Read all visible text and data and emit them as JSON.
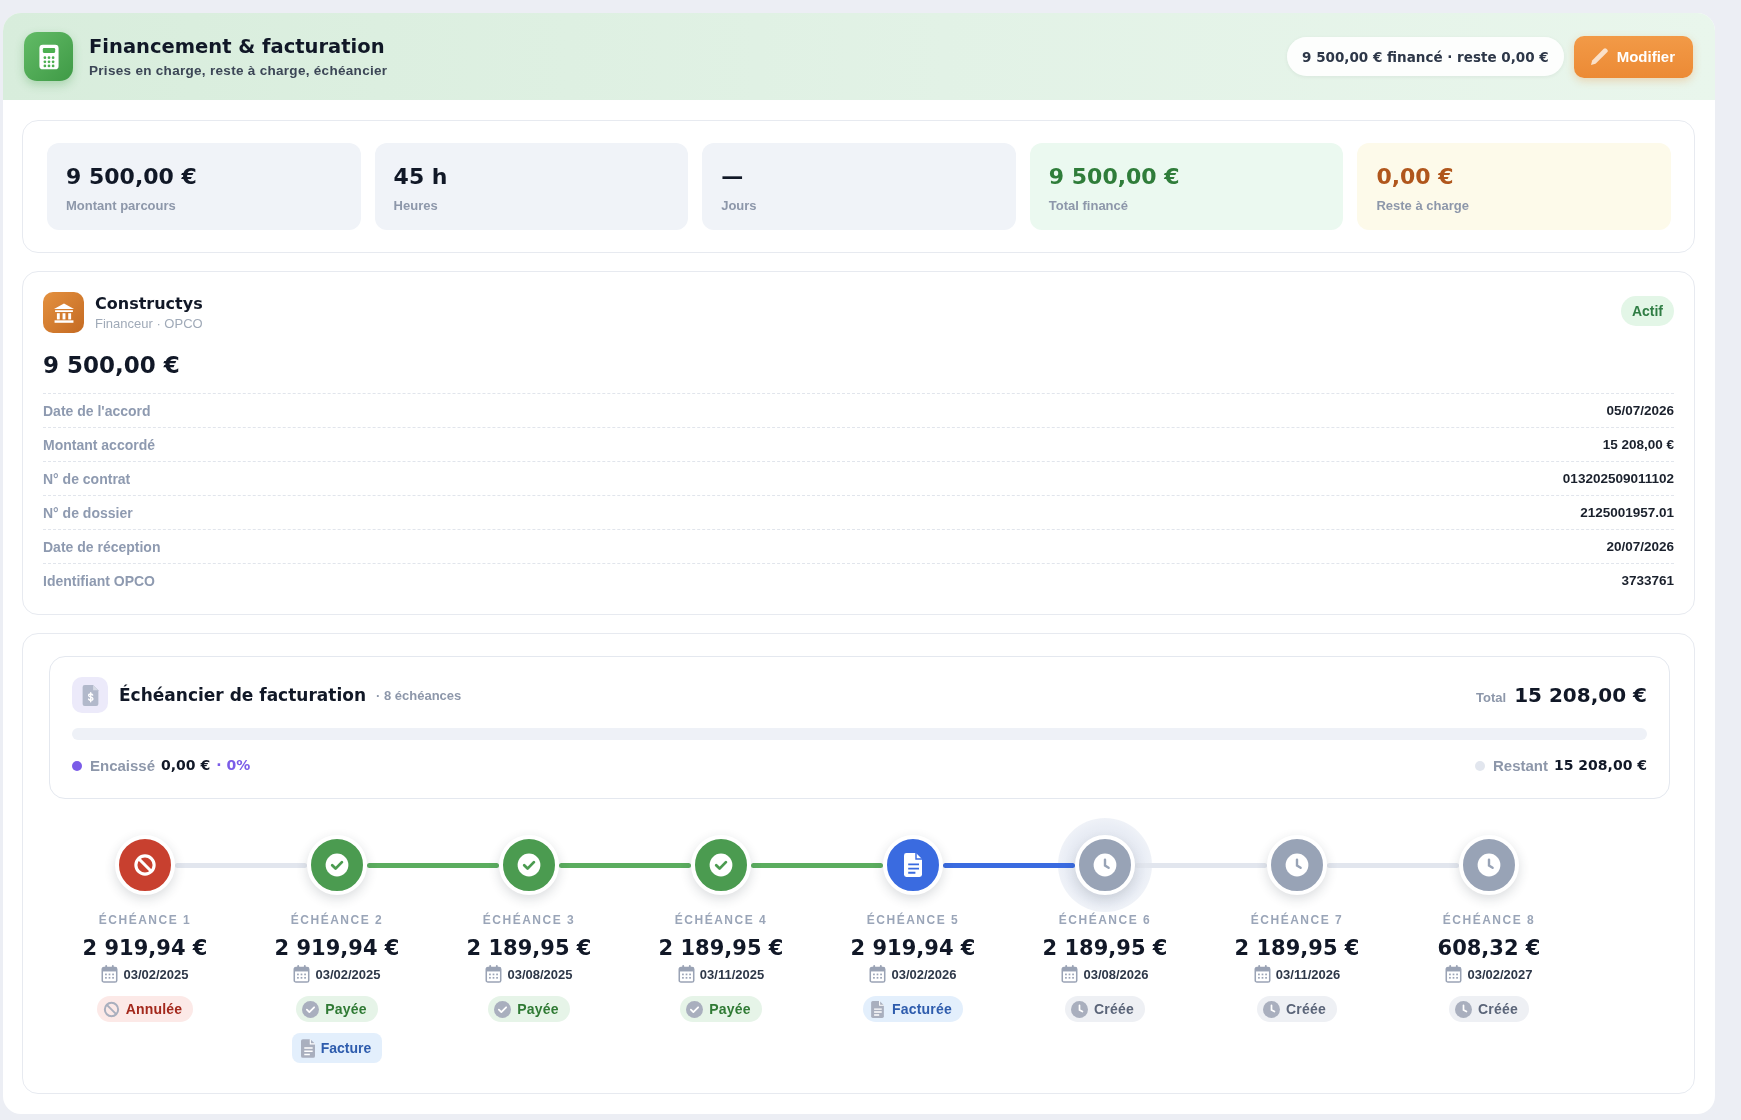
{
  "header": {
    "title": "Financement & facturation",
    "subtitle": "Prises en charge, reste à charge, échéancier",
    "summary": "9 500,00 € financé · reste 0,00 €",
    "action": "Modifier"
  },
  "stats": [
    {
      "value": "9 500,00 €",
      "label": "Montant parcours",
      "kind": "neutral"
    },
    {
      "value": "45 h",
      "label": "Heures",
      "kind": "neutral"
    },
    {
      "value": "—",
      "label": "Jours",
      "kind": "neutral"
    },
    {
      "value": "9 500,00 €",
      "label": "Total financé",
      "kind": "funded"
    },
    {
      "value": "0,00 €",
      "label": "Reste à charge",
      "kind": "remaining"
    }
  ],
  "financer": {
    "name": "Constructys",
    "subtitle": "Financeur · OPCO",
    "status": "Actif",
    "amount": "9 500,00 €",
    "details": [
      {
        "label": "Date de l'accord",
        "value": "05/07/2026"
      },
      {
        "label": "Montant accordé",
        "value": "15 208,00 €"
      },
      {
        "label": "N° de contrat",
        "value": "013202509011102"
      },
      {
        "label": "N° de dossier",
        "value": "2125001957.01"
      },
      {
        "label": "Date de réception",
        "value": "20/07/2026"
      },
      {
        "label": "Identifiant OPCO",
        "value": "3733761"
      }
    ]
  },
  "schedule": {
    "title": "Échéancier de facturation",
    "count": "· 8 échéances",
    "total_label": "Total",
    "total": "15 208,00 €",
    "progress": {
      "collected": {
        "label": "Encaissé",
        "amount": "0,00 €",
        "percent": "· 0%"
      },
      "remaining": {
        "label": "Restant",
        "amount": "15 208,00 €"
      }
    },
    "items": [
      {
        "label": "ÉCHÉANCE 1",
        "amount": "2 919,94 €",
        "date": "03/02/2025",
        "kind": "cancelled",
        "status": "Annulée",
        "current": false
      },
      {
        "label": "ÉCHÉANCE 2",
        "amount": "2 919,94 €",
        "date": "03/02/2025",
        "kind": "paid",
        "status": "Payée",
        "current": false,
        "invoice": "Facture"
      },
      {
        "label": "ÉCHÉANCE 3",
        "amount": "2 189,95 €",
        "date": "03/08/2025",
        "kind": "paid",
        "status": "Payée",
        "current": false
      },
      {
        "label": "ÉCHÉANCE 4",
        "amount": "2 189,95 €",
        "date": "03/11/2025",
        "kind": "paid",
        "status": "Payée",
        "current": false
      },
      {
        "label": "ÉCHÉANCE 5",
        "amount": "2 919,94 €",
        "date": "03/02/2026",
        "kind": "invoiced",
        "status": "Facturée",
        "current": false
      },
      {
        "label": "ÉCHÉANCE 6",
        "amount": "2 189,95 €",
        "date": "03/08/2026",
        "kind": "created",
        "status": "Créée",
        "current": true
      },
      {
        "label": "ÉCHÉANCE 7",
        "amount": "2 189,95 €",
        "date": "03/11/2026",
        "kind": "created",
        "status": "Créée",
        "current": false
      },
      {
        "label": "ÉCHÉANCE 8",
        "amount": "608,32 €",
        "date": "03/02/2027",
        "kind": "created",
        "status": "Créée",
        "current": false
      }
    ]
  }
}
